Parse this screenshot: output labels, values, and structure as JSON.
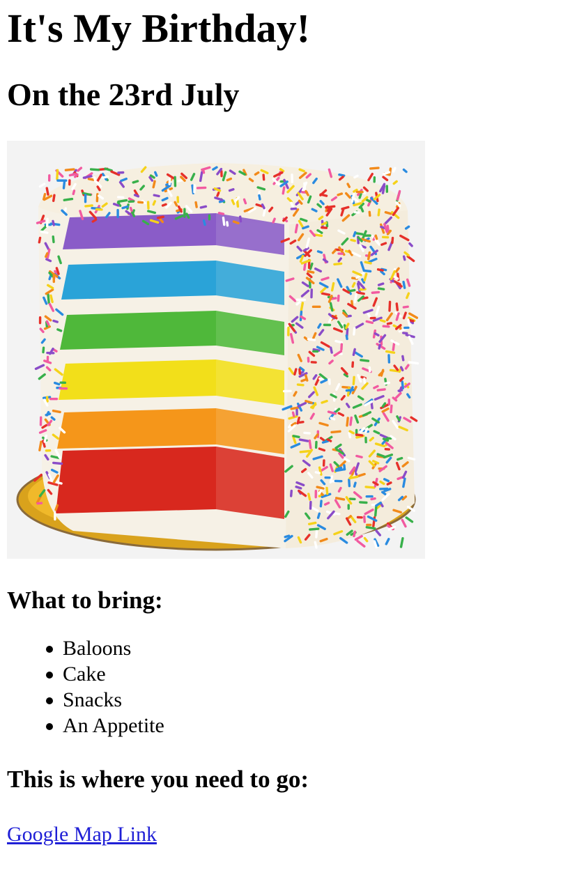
{
  "page": {
    "title": "It's My Birthday!",
    "date_heading": "On the 23rd July",
    "bring_heading": "What to bring:",
    "bring_items": [
      "Baloons",
      "Cake",
      "Snacks",
      "An Appetite"
    ],
    "location_heading": "This is where you need to go:",
    "map_link_label": "Google Map Link"
  },
  "image": {
    "alt": "Rainbow layer cake with sprinkles",
    "layer_colors": [
      "#8a5cc8",
      "#2aa3d8",
      "#4fb83a",
      "#f2df1a",
      "#f5961a",
      "#d8281e"
    ],
    "sprinkle_colors": [
      "#e6302a",
      "#f28a1a",
      "#f5d21a",
      "#38b04a",
      "#2a8be0",
      "#8a4cc8",
      "#f25aa0",
      "#ffffff"
    ]
  },
  "colors": {
    "link": "#1f1fd6",
    "text": "#000000"
  }
}
